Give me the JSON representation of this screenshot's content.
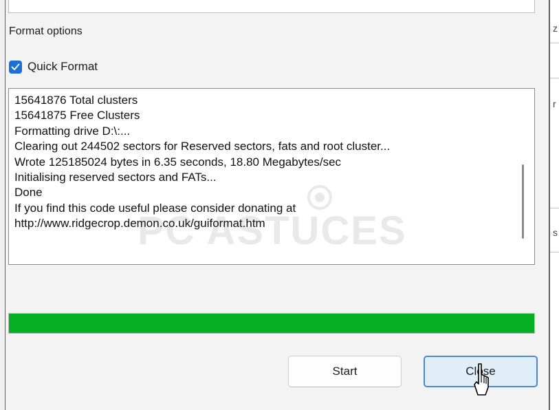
{
  "format_options": {
    "section_label": "Format options",
    "quick_format": {
      "label": "Quick Format",
      "checked": true
    }
  },
  "log": {
    "lines": [
      "15641876 Total clusters",
      "15641875 Free Clusters",
      "Formatting drive D:\\:...",
      "Clearing out 244502 sectors for Reserved sectors, fats and root cluster...",
      "Wrote 125185024 bytes in 6.35 seconds, 18.80 Megabytes/sec",
      "Initialising reserved sectors and FATs...",
      "Done",
      "If you find this code useful please consider donating at",
      "http://www.ridgecrop.demon.co.uk/guiformat.htm"
    ]
  },
  "progress": {
    "fraction": 1.0,
    "color": "#06b025"
  },
  "buttons": {
    "start": "Start",
    "close": "Close"
  },
  "watermark": {
    "text": "PC ASTUCES"
  },
  "colors": {
    "accent": "#1b6fd6",
    "focus_border": "#4a89d0"
  },
  "icons": {
    "checkbox": "checkmark-icon",
    "cursor": "pointer-cursor-icon"
  }
}
